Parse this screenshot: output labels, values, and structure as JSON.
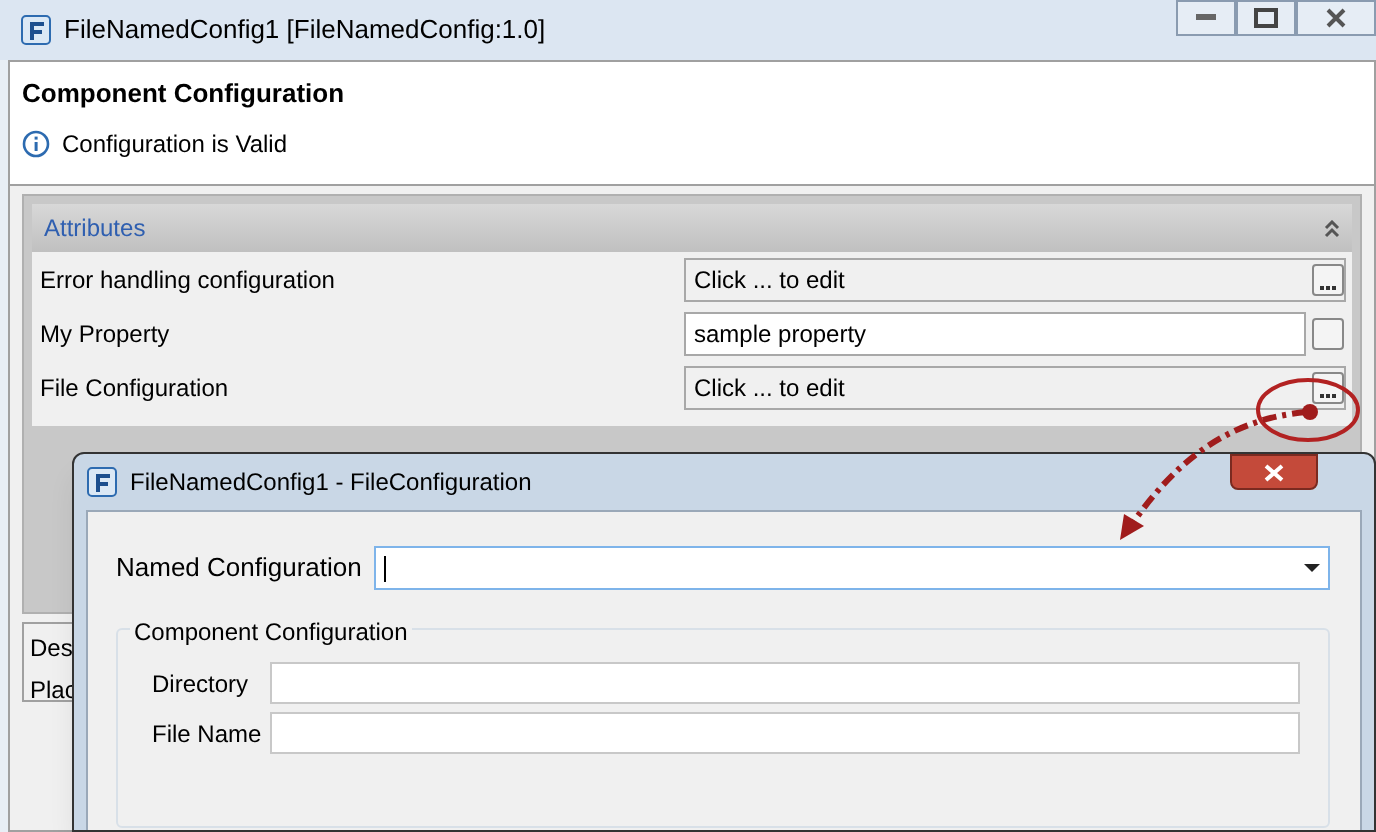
{
  "window": {
    "title": "FileNamedConfig1 [FileNamedConfig:1.0]"
  },
  "header": {
    "title": "Component Configuration",
    "message": "Configuration is Valid"
  },
  "attributes": {
    "title": "Attributes",
    "rows": [
      {
        "label": "Error handling configuration",
        "value": "Click ... to edit",
        "kind": "dialog"
      },
      {
        "label": "My Property",
        "value": "sample property",
        "kind": "text"
      },
      {
        "label": "File Configuration",
        "value": "Click ... to edit",
        "kind": "dialog"
      }
    ]
  },
  "lower_panel": {
    "items": [
      "Des",
      "Plac"
    ]
  },
  "dialog": {
    "title": "FileNamedConfig1 - FileConfiguration",
    "named_configuration": {
      "label": "Named Configuration"
    },
    "group": {
      "title": "Component Configuration",
      "fields": [
        {
          "label": "Directory"
        },
        {
          "label": "File Name"
        }
      ]
    }
  }
}
